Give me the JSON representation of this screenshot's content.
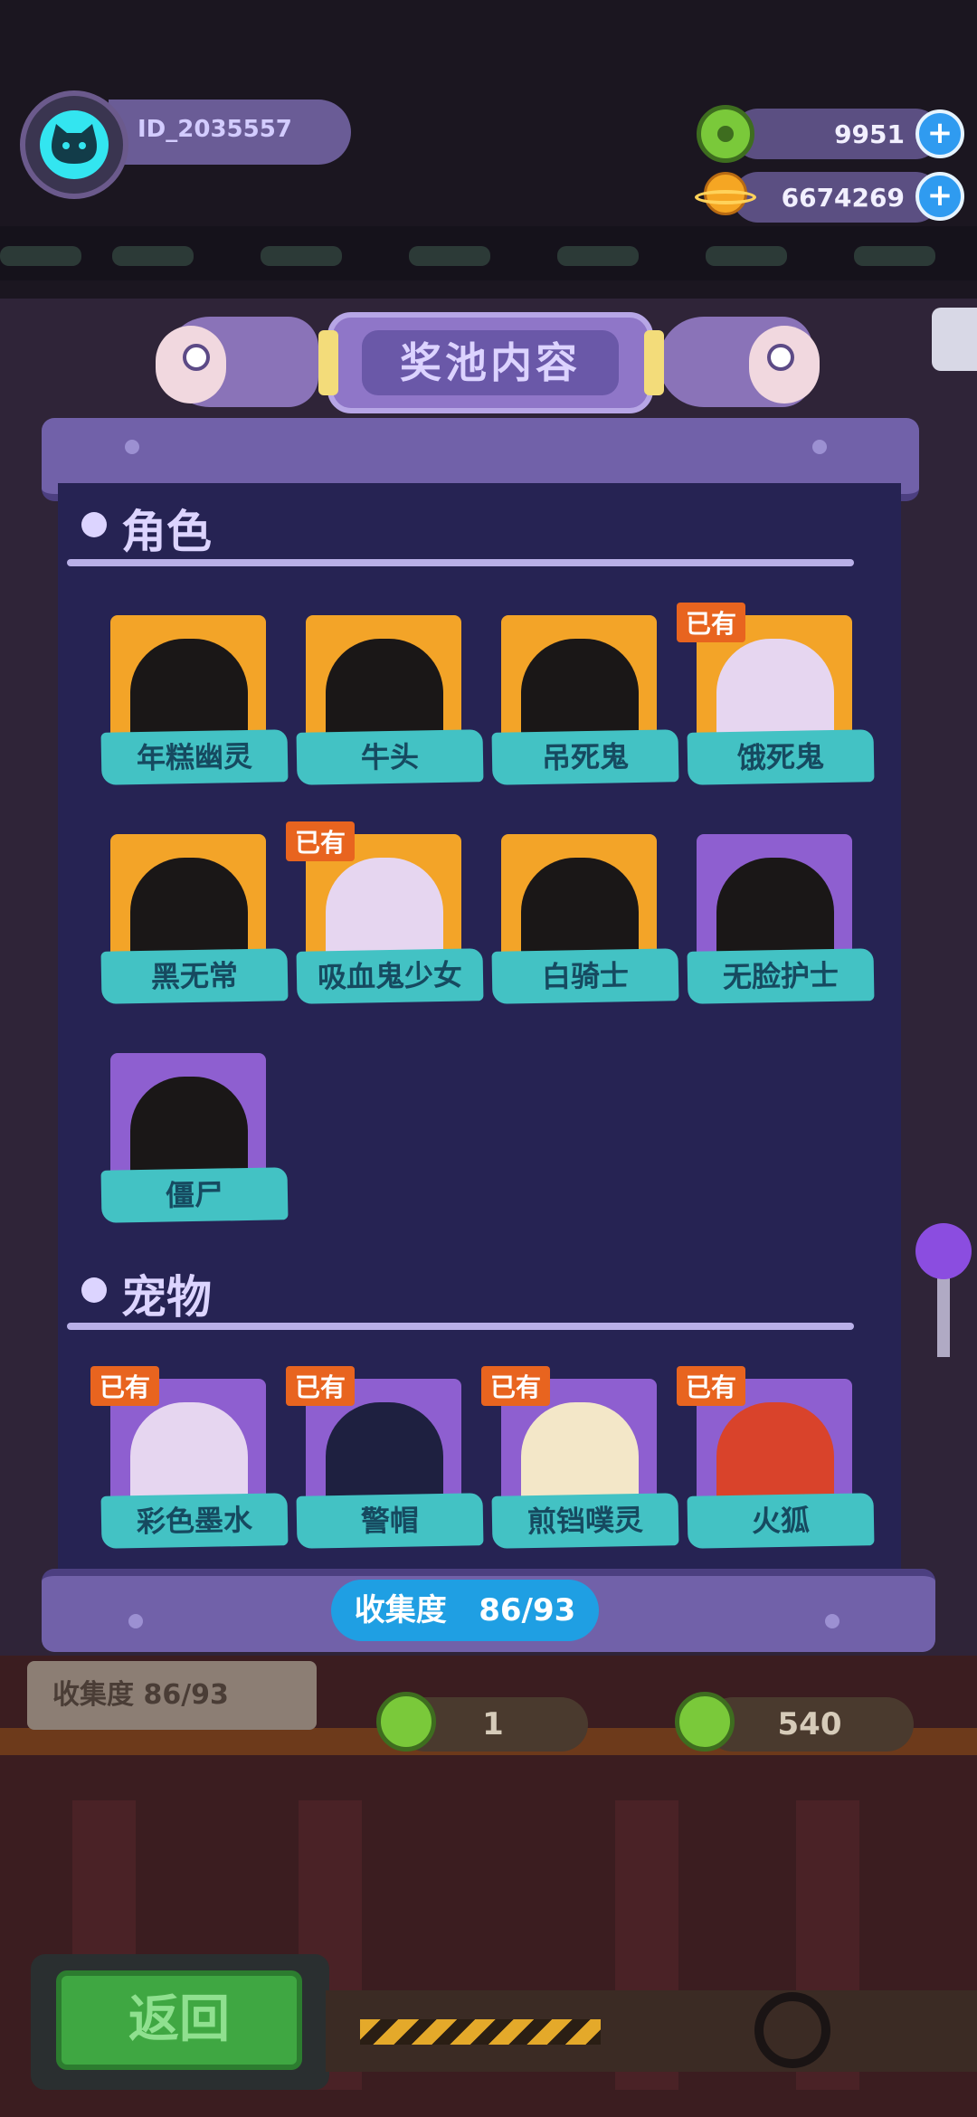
{
  "player": {
    "id": "ID_2035557"
  },
  "currencies": [
    {
      "name": "donut",
      "value": "9951",
      "plus": "+"
    },
    {
      "name": "planet",
      "value": "6674269",
      "plus": "+"
    }
  ],
  "header": {
    "title": "奖池内容"
  },
  "sections": {
    "characters": {
      "title": "角色",
      "items": [
        {
          "name": "年糕幽灵",
          "owned": false
        },
        {
          "name": "牛头",
          "owned": false
        },
        {
          "name": "吊死鬼",
          "owned": false
        },
        {
          "name": "饿死鬼",
          "owned": true
        },
        {
          "name": "黑无常",
          "owned": false
        },
        {
          "name": "吸血鬼少女",
          "owned": true
        },
        {
          "name": "白骑士",
          "owned": false
        },
        {
          "name": "无脸护士",
          "owned": false
        },
        {
          "name": "僵尸",
          "owned": false
        }
      ]
    },
    "pets": {
      "title": "宠物",
      "items": [
        {
          "name": "彩色墨水",
          "owned": true
        },
        {
          "name": "警帽",
          "owned": true
        },
        {
          "name": "煎铛噗灵",
          "owned": true
        },
        {
          "name": "火狐",
          "owned": true
        }
      ]
    }
  },
  "owned_badge": "已有",
  "collection": {
    "label": "收集度",
    "value": "86/93"
  },
  "background": {
    "collection_box": "收集度    86/93",
    "cost_single": "1",
    "cost_multi": "540",
    "back_button": "返回"
  },
  "colors": {
    "panel": "#262353",
    "gold_tile": "#f3a428",
    "purple_tile": "#8e5fd0",
    "label_teal": "#43c2c4",
    "owned_badge": "#e8641f",
    "progress": "#1f9fe3"
  }
}
